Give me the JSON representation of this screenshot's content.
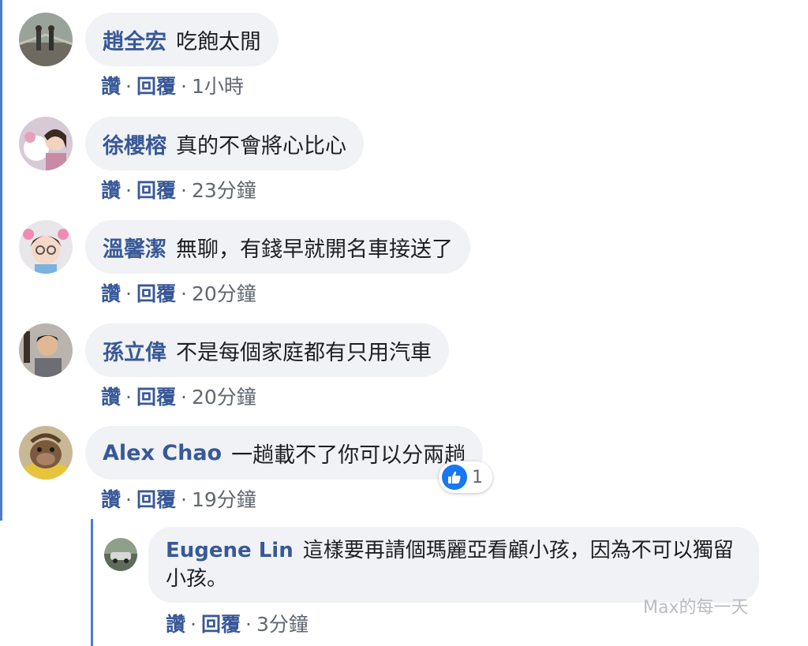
{
  "comments": [
    {
      "name": "趙全宏",
      "text": "吃飽太閒",
      "like": "讚",
      "reply": "回覆",
      "sep": "·",
      "time": "1小時"
    },
    {
      "name": "徐櫻榕",
      "text": "真的不會將心比心",
      "like": "讚",
      "reply": "回覆",
      "sep": "·",
      "time": "23分鐘"
    },
    {
      "name": "溫馨潔",
      "text": "無聊，有錢早就開名車接送了",
      "like": "讚",
      "reply": "回覆",
      "sep": "·",
      "time": "20分鐘"
    },
    {
      "name": "孫立偉",
      "text": "不是每個家庭都有只用汽車",
      "like": "讚",
      "reply": "回覆",
      "sep": "·",
      "time": "20分鐘"
    },
    {
      "name": "Alex Chao",
      "text": "一趟載不了你可以分兩趟",
      "like": "讚",
      "reply": "回覆",
      "sep": "·",
      "time": "19分鐘",
      "reaction_count": "1"
    }
  ],
  "reply": {
    "name": "Eugene Lin",
    "text": "這樣要再請個瑪麗亞看顧小孩，因為不可以獨留小孩。",
    "like": "讚",
    "reply": "回覆",
    "sep": "·",
    "time": "3分鐘"
  },
  "watermark": "Max的每一天",
  "colors": {
    "name": "#385898",
    "bubble": "#f0f2f5",
    "thread_line": "#4a7bd0",
    "like_blue": "#1877f2"
  }
}
